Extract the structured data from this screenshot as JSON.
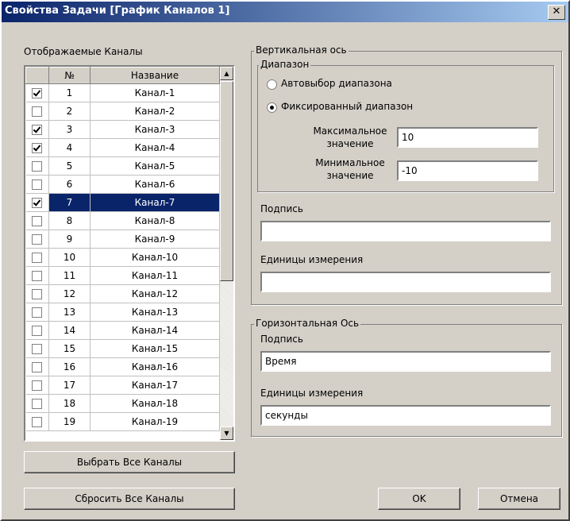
{
  "window": {
    "title": "Свойства Задачи [График Каналов 1]",
    "close_label": "✕"
  },
  "channels": {
    "label": "Отображаемые Каналы",
    "columns": {
      "check": "",
      "num": "№",
      "name": "Название"
    },
    "rows": [
      {
        "checked": true,
        "num": "1",
        "name": "Канал-1",
        "selected": false
      },
      {
        "checked": false,
        "num": "2",
        "name": "Канал-2",
        "selected": false
      },
      {
        "checked": true,
        "num": "3",
        "name": "Канал-3",
        "selected": false
      },
      {
        "checked": true,
        "num": "4",
        "name": "Канал-4",
        "selected": false
      },
      {
        "checked": false,
        "num": "5",
        "name": "Канал-5",
        "selected": false
      },
      {
        "checked": false,
        "num": "6",
        "name": "Канал-6",
        "selected": false
      },
      {
        "checked": true,
        "num": "7",
        "name": "Канал-7",
        "selected": true
      },
      {
        "checked": false,
        "num": "8",
        "name": "Канал-8",
        "selected": false
      },
      {
        "checked": false,
        "num": "9",
        "name": "Канал-9",
        "selected": false
      },
      {
        "checked": false,
        "num": "10",
        "name": "Канал-10",
        "selected": false
      },
      {
        "checked": false,
        "num": "11",
        "name": "Канал-11",
        "selected": false
      },
      {
        "checked": false,
        "num": "12",
        "name": "Канал-12",
        "selected": false
      },
      {
        "checked": false,
        "num": "13",
        "name": "Канал-13",
        "selected": false
      },
      {
        "checked": false,
        "num": "14",
        "name": "Канал-14",
        "selected": false
      },
      {
        "checked": false,
        "num": "15",
        "name": "Канал-15",
        "selected": false
      },
      {
        "checked": false,
        "num": "16",
        "name": "Канал-16",
        "selected": false
      },
      {
        "checked": false,
        "num": "17",
        "name": "Канал-17",
        "selected": false
      },
      {
        "checked": false,
        "num": "18",
        "name": "Канал-18",
        "selected": false
      },
      {
        "checked": false,
        "num": "19",
        "name": "Канал-19",
        "selected": false
      }
    ],
    "select_all": "Выбрать Все Каналы",
    "reset_all": "Сбросить Все Каналы"
  },
  "vertical_axis": {
    "group_label": "Вертикальная ось",
    "range_label": "Диапазон",
    "auto_label": "Автовыбор диапазона",
    "fixed_label": "Фиксированный диапазон",
    "range_mode": "fixed",
    "max_label_1": "Максимальное",
    "max_label_2": "значение",
    "max_value": "10",
    "min_label_1": "Минимальное",
    "min_label_2": "значение",
    "min_value": "-10",
    "caption_label": "Подпись",
    "caption_value": "",
    "units_label": "Единицы измерения",
    "units_value": ""
  },
  "horizontal_axis": {
    "group_label": "Горизонтальная Ось",
    "caption_label": "Подпись",
    "caption_value": "Время",
    "units_label": "Единицы измерения",
    "units_value": "секунды"
  },
  "buttons": {
    "ok": "OK",
    "cancel": "Отмена"
  },
  "colors": {
    "title_start": "#0a246a",
    "title_end": "#a6caf0",
    "face": "#d4d0c8",
    "selection": "#0a246a"
  }
}
